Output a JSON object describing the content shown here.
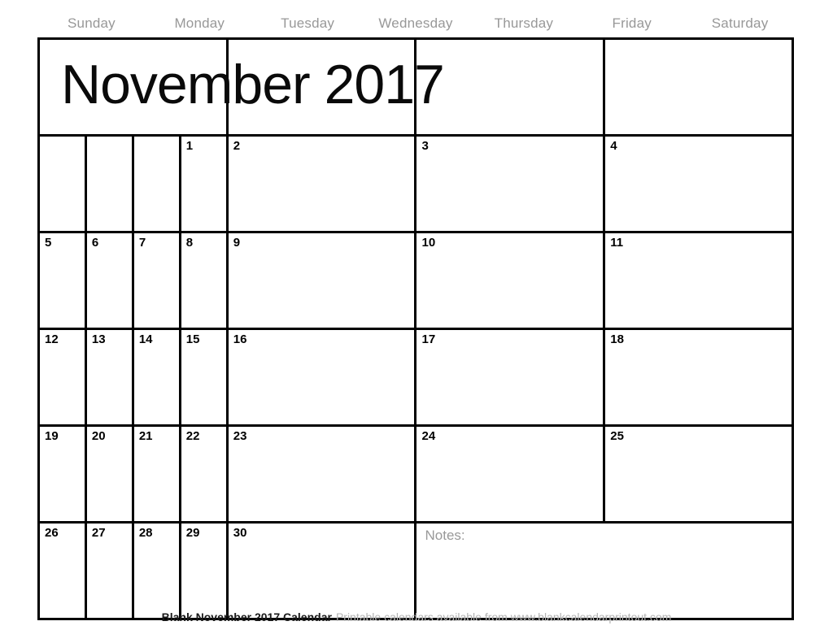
{
  "document": {
    "title": "November 2017",
    "month": "November",
    "year": "2017"
  },
  "weekdays": [
    {
      "label": "Sunday"
    },
    {
      "label": "Monday"
    },
    {
      "label": "Tuesday"
    },
    {
      "label": "Wednesday"
    },
    {
      "label": "Thursday"
    },
    {
      "label": "Friday"
    },
    {
      "label": "Saturday"
    }
  ],
  "grid": {
    "rows": [
      {
        "type": "title",
        "title": "November 2017",
        "blank_cells": 3
      },
      {
        "type": "week",
        "days": [
          "",
          "",
          "",
          "1",
          "2",
          "3",
          "4"
        ]
      },
      {
        "type": "week",
        "days": [
          "5",
          "6",
          "7",
          "8",
          "9",
          "10",
          "11"
        ]
      },
      {
        "type": "week",
        "days": [
          "12",
          "13",
          "14",
          "15",
          "16",
          "17",
          "18"
        ]
      },
      {
        "type": "week",
        "days": [
          "19",
          "20",
          "21",
          "22",
          "23",
          "24",
          "25"
        ]
      },
      {
        "type": "week-notes",
        "days": [
          "26",
          "27",
          "28",
          "29",
          "30"
        ],
        "notes_label": "Notes:"
      }
    ]
  },
  "footer": {
    "title": "Blank November 2017 Calendar",
    "note": "Printable calendars available from www.blankcalendarprintout.com"
  },
  "colors": {
    "grid_line": "#000000",
    "weekday_text": "#989898",
    "title_text": "#0a0a0a",
    "daynum_text": "#000000",
    "notes_text": "#999999",
    "footer_title": "#1a1a1a",
    "footer_note": "#b4b4b4",
    "background": "#ffffff"
  }
}
